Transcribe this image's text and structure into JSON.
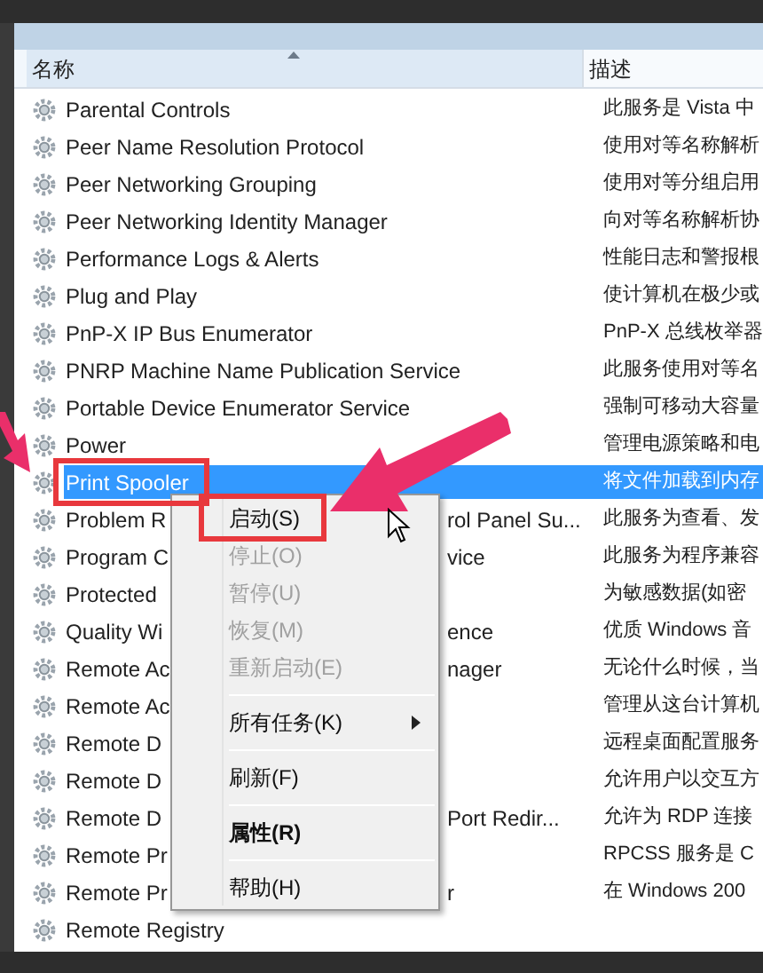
{
  "columns": [
    {
      "label": "名称",
      "sorted": true
    },
    {
      "label": "描述",
      "sorted": false
    }
  ],
  "services": [
    {
      "name": "Parental Controls",
      "description": "此服务是 Vista 中",
      "selected": false
    },
    {
      "name": "Peer Name Resolution Protocol",
      "description": "使用对等名称解析",
      "selected": false
    },
    {
      "name": "Peer Networking Grouping",
      "description": "使用对等分组启用",
      "selected": false
    },
    {
      "name": "Peer Networking Identity Manager",
      "description": "向对等名称解析协",
      "selected": false
    },
    {
      "name": "Performance Logs & Alerts",
      "description": "性能日志和警报根",
      "selected": false
    },
    {
      "name": "Plug and Play",
      "description": "使计算机在极少或",
      "selected": false
    },
    {
      "name": "PnP-X IP Bus Enumerator",
      "description": "PnP-X 总线枚举器",
      "selected": false
    },
    {
      "name": "PNRP Machine Name Publication Service",
      "description": "此服务使用对等名",
      "selected": false
    },
    {
      "name": "Portable Device Enumerator Service",
      "description": "强制可移动大容量",
      "selected": false
    },
    {
      "name": "Power",
      "description": "管理电源策略和电",
      "selected": false
    },
    {
      "name": "Print Spooler",
      "description": "将文件加载到内存",
      "selected": true
    },
    {
      "name": "Problem R",
      "name_tail": "rol Panel Su...",
      "description": "此服务为查看、发",
      "selected": false
    },
    {
      "name": "Program C",
      "name_tail": "vice",
      "description": "此服务为程序兼容",
      "selected": false
    },
    {
      "name": "Protected",
      "description": "为敏感数据(如密",
      "selected": false
    },
    {
      "name": "Quality Wi",
      "name_tail": "ence",
      "description": "优质 Windows 音",
      "selected": false
    },
    {
      "name": "Remote Ac",
      "name_tail": "nager",
      "description": "无论什么时候，当",
      "selected": false
    },
    {
      "name": "Remote Ac",
      "description": "管理从这台计算机",
      "selected": false
    },
    {
      "name": "Remote D",
      "description": "远程桌面配置服务",
      "selected": false
    },
    {
      "name": "Remote D",
      "description": "允许用户以交互方",
      "selected": false
    },
    {
      "name": "Remote D",
      "name_tail": "Port Redir...",
      "description": "允许为 RDP 连接",
      "selected": false
    },
    {
      "name": "Remote Pr",
      "description": "RPCSS 服务是 C",
      "selected": false
    },
    {
      "name": "Remote Pr",
      "name_tail": "r",
      "description": "在 Windows 200",
      "selected": false
    },
    {
      "name": "Remote Registry",
      "selected": false
    }
  ],
  "context_menu": [
    {
      "kind": "item",
      "label": "启动(S)",
      "disabled": false
    },
    {
      "kind": "item",
      "label": "停止(O)",
      "disabled": true
    },
    {
      "kind": "item",
      "label": "暂停(U)",
      "disabled": true
    },
    {
      "kind": "item",
      "label": "恢复(M)",
      "disabled": true
    },
    {
      "kind": "item",
      "label": "重新启动(E)",
      "disabled": true
    },
    {
      "kind": "separator"
    },
    {
      "kind": "submenu",
      "label": "所有任务(K)",
      "disabled": false
    },
    {
      "kind": "separator"
    },
    {
      "kind": "item",
      "label": "刷新(F)",
      "disabled": false
    },
    {
      "kind": "separator"
    },
    {
      "kind": "default",
      "label": "属性(R)",
      "disabled": false
    },
    {
      "kind": "separator"
    },
    {
      "kind": "item",
      "label": "帮助(H)",
      "disabled": false
    }
  ]
}
